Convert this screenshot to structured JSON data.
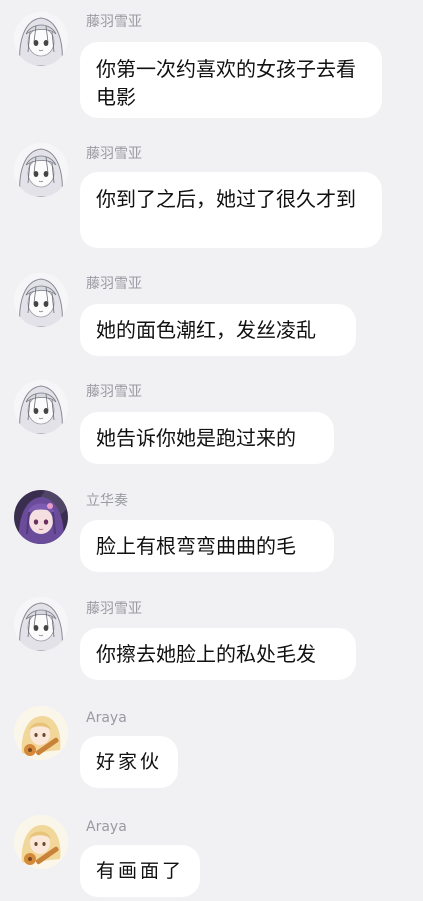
{
  "messages": [
    {
      "sender": "藤羽雪亚",
      "text": "你第一次约喜欢的女孩子去看电影",
      "avatar": "white-hair-anime-girl"
    },
    {
      "sender": "藤羽雪亚",
      "text": "你到了之后，她过了很久才到",
      "avatar": "white-hair-anime-girl"
    },
    {
      "sender": "藤羽雪亚",
      "text": "她的面色潮红，发丝凌乱",
      "avatar": "white-hair-anime-girl"
    },
    {
      "sender": "藤羽雪亚",
      "text": "她告诉你她是跑过来的",
      "avatar": "white-hair-anime-girl"
    },
    {
      "sender": "立华奏",
      "text": "脸上有根弯弯曲曲的毛",
      "avatar": "purple-hair-anime-girl"
    },
    {
      "sender": "藤羽雪亚",
      "text": "你擦去她脸上的私处毛发",
      "avatar": "white-hair-anime-girl"
    },
    {
      "sender": "Araya",
      "text": "好家伙",
      "avatar": "blonde-anime-girl-with-guitar"
    },
    {
      "sender": "Araya",
      "text": "有画面了",
      "avatar": "blonde-anime-girl-with-guitar"
    }
  ],
  "colors": {
    "background": "#f1f1f4",
    "bubble": "#ffffff",
    "sender_name": "#9a9aa2",
    "text": "#111111"
  }
}
